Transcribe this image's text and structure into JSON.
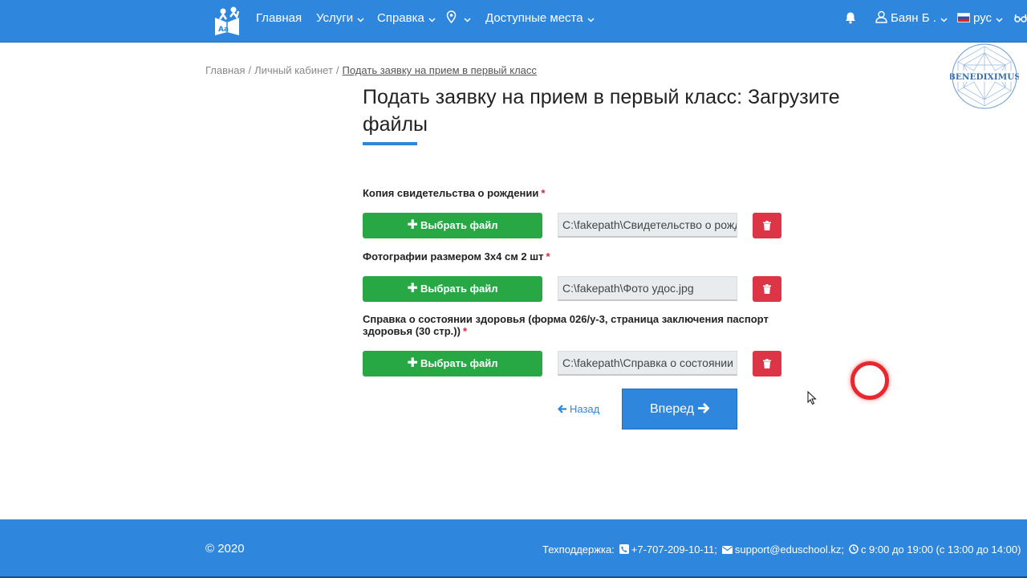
{
  "nav": {
    "home": "Главная",
    "services": "Услуги",
    "help": "Справка",
    "places": "Доступные места",
    "user": "Баян Б .",
    "lang": "рус"
  },
  "watermark": "BENEDIXIMUS",
  "breadcrumb": {
    "home": "Главная",
    "cabinet": "Личный кабинет",
    "current": "Подать заявку на прием в первый класс",
    "separator": "/"
  },
  "page_title": "Подать заявку на прием в первый класс: Загрузите файлы",
  "fields": [
    {
      "label": "Копия свидетельства о рождении",
      "button": "Выбрать файл",
      "path": "C:\\fakepath\\Свидетельство о рождении.jpg"
    },
    {
      "label": "Фотографии размером 3х4 см 2 шт",
      "button": "Выбрать файл",
      "path": "C:\\fakepath\\Фото удос.jpg"
    },
    {
      "label": "Справка о состоянии здоровья (форма 026/у-3, страница заключения паспорт здоровья (30 стр.))",
      "button": "Выбрать файл",
      "path": "C:\\fakepath\\Справка о состоянии здоровья.jpg"
    }
  ],
  "required_mark": "*",
  "buttons": {
    "back": "Назад",
    "next": "Вперед"
  },
  "footer": {
    "copyright": "© 2020",
    "support_label": "Техподдержка:",
    "phone": "+7-707-209-10-11;",
    "email": "support@eduschool.kz;",
    "hours": "с 9:00 до 19:00 (с 13:00 до 14:00)"
  },
  "colors": {
    "primary": "#2f86dd",
    "success": "#28a745",
    "danger": "#dc3545"
  }
}
